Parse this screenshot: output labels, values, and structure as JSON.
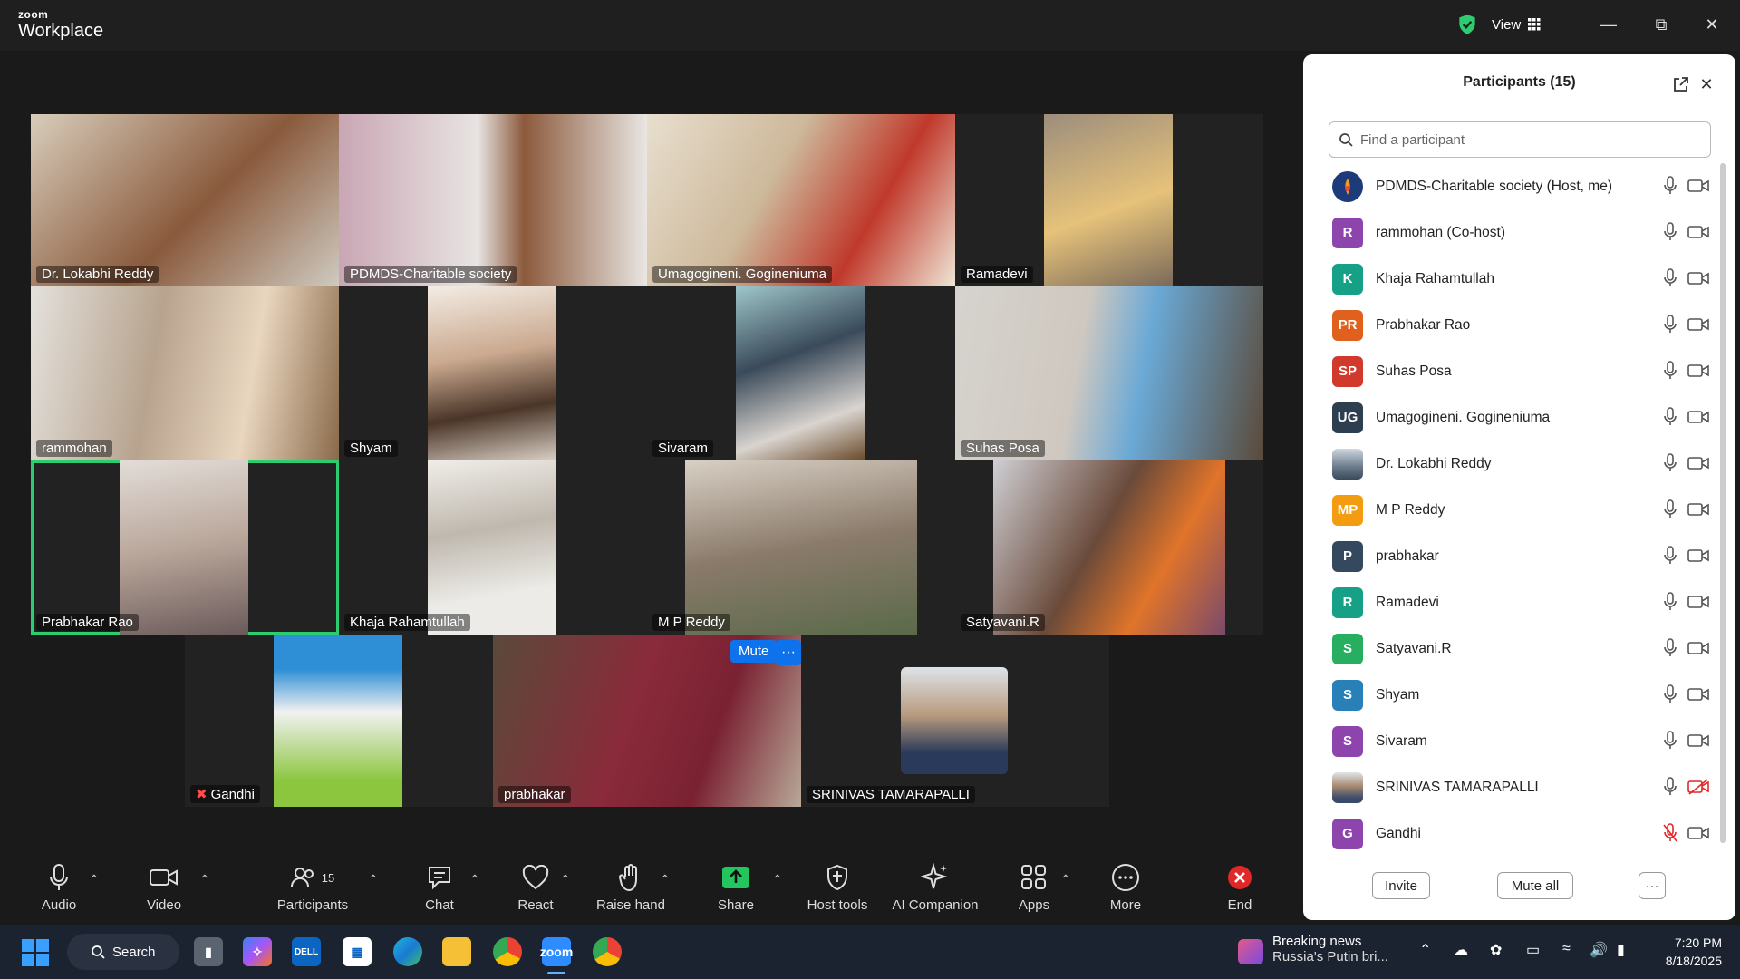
{
  "app": {
    "brand_small": "zoom",
    "brand_big": "Workplace",
    "view_label": "View"
  },
  "colors": {
    "accent": "#0e72ed",
    "active_speaker": "#2ecc71",
    "end_red": "#e02828"
  },
  "tiles": [
    {
      "name": "Dr. Lokabhi Reddy"
    },
    {
      "name": "PDMDS-Charitable society"
    },
    {
      "name": "Umagogineni. Gogineniuma"
    },
    {
      "name": "Ramadevi"
    },
    {
      "name": "rammohan"
    },
    {
      "name": "Shyam"
    },
    {
      "name": "Sivaram"
    },
    {
      "name": "Suhas Posa"
    },
    {
      "name": "Prabhakar Rao"
    },
    {
      "name": "Khaja Rahamtullah"
    },
    {
      "name": "M P Reddy"
    },
    {
      "name": "Satyavani.R"
    },
    {
      "name": "Gandhi"
    },
    {
      "name": "prabhakar"
    },
    {
      "name": "SRINIVAS TAMARAPALLI"
    }
  ],
  "tile_controls": {
    "mute": "Mute",
    "more": "···"
  },
  "toolbar": {
    "audio": "Audio",
    "video": "Video",
    "participants": "Participants",
    "participant_count": "15",
    "chat": "Chat",
    "react": "React",
    "raise_hand": "Raise hand",
    "share": "Share",
    "host_tools": "Host tools",
    "ai_companion": "AI Companion",
    "apps": "Apps",
    "more": "More",
    "end": "End"
  },
  "panel": {
    "title": "Participants (15)",
    "search_placeholder": "Find a participant",
    "participants": [
      {
        "initials": "",
        "name": "PDMDS-Charitable society (Host, me)",
        "color": "#1d3a7a",
        "mic": "on",
        "cam": "on"
      },
      {
        "initials": "R",
        "name": "rammohan (Co-host)",
        "color": "#8e44ad",
        "mic": "on",
        "cam": "on"
      },
      {
        "initials": "K",
        "name": "Khaja Rahamtullah",
        "color": "#16a085",
        "mic": "on",
        "cam": "on"
      },
      {
        "initials": "PR",
        "name": "Prabhakar Rao",
        "color": "#e0601e",
        "mic": "on",
        "cam": "on"
      },
      {
        "initials": "SP",
        "name": "Suhas Posa",
        "color": "#d0392b",
        "mic": "on",
        "cam": "on"
      },
      {
        "initials": "UG",
        "name": "Umagogineni. Gogineniuma",
        "color": "#2c3e50",
        "mic": "on",
        "cam": "on"
      },
      {
        "initials": "",
        "name": "Dr. Lokabhi Reddy",
        "color": "#7a8fa6",
        "mic": "on",
        "cam": "on"
      },
      {
        "initials": "MP",
        "name": "M P Reddy",
        "color": "#f39c12",
        "mic": "on",
        "cam": "on"
      },
      {
        "initials": "P",
        "name": "prabhakar",
        "color": "#34495e",
        "mic": "on",
        "cam": "on"
      },
      {
        "initials": "R",
        "name": "Ramadevi",
        "color": "#16a085",
        "mic": "on",
        "cam": "on"
      },
      {
        "initials": "S",
        "name": "Satyavani.R",
        "color": "#27ae60",
        "mic": "on",
        "cam": "on"
      },
      {
        "initials": "S",
        "name": "Shyam",
        "color": "#2980b9",
        "mic": "on",
        "cam": "on"
      },
      {
        "initials": "S",
        "name": "Sivaram",
        "color": "#8e44ad",
        "mic": "on",
        "cam": "on"
      },
      {
        "initials": "",
        "name": "SRINIVAS TAMARAPALLI",
        "color": "#8a8a8a",
        "mic": "on",
        "cam": "off"
      },
      {
        "initials": "G",
        "name": "Gandhi",
        "color": "#8e44ad",
        "mic": "off",
        "cam": "on"
      }
    ],
    "invite": "Invite",
    "mute_all": "Mute all",
    "more": "···"
  },
  "taskbar": {
    "search": "Search",
    "news_title": "Breaking news",
    "news_sub": "Russia's Putin bri...",
    "time": "7:20 PM",
    "date": "8/18/2025"
  }
}
